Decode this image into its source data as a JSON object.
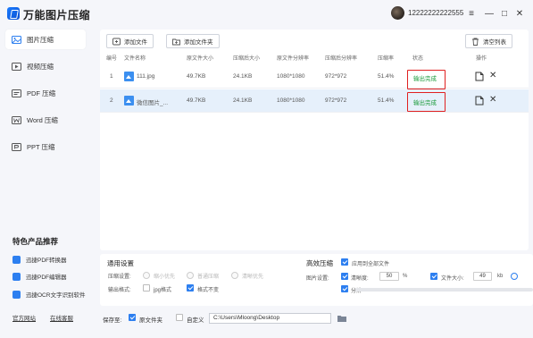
{
  "app": {
    "title": "万能图片压缩",
    "user_phone": "12222222222555"
  },
  "window_controls": {
    "list_icon": "≡",
    "minimize": "—",
    "maximize": "□",
    "close": "✕"
  },
  "sidebar": {
    "items": [
      {
        "label": "图片压缩",
        "icon": "image-icon"
      },
      {
        "label": "视频压缩",
        "icon": "video-icon"
      },
      {
        "label": "PDF 压缩",
        "icon": "pdf-icon"
      },
      {
        "label": "Word 压缩",
        "icon": "word-icon"
      },
      {
        "label": "PPT 压缩",
        "icon": "ppt-icon"
      }
    ],
    "feature_title": "特色产品推荐",
    "features": [
      {
        "label": "迅捷PDF转换器",
        "color": "#2d7ff0"
      },
      {
        "label": "迅捷PDF编辑器",
        "color": "#2d7ff0"
      },
      {
        "label": "迅捷OCR文字识别软件",
        "color": "#2d7ff0"
      }
    ],
    "footer": {
      "official_site": "官方网站",
      "feedback": "在线客服"
    }
  },
  "toolbar": {
    "add_file": "添加文件",
    "add_folder": "添加文件夹",
    "clear_list": "清空列表"
  },
  "table": {
    "headers": {
      "index": "编号",
      "name": "文件名称",
      "orig_size": "原文件大小",
      "new_size": "压缩后大小",
      "orig_res": "原文件分辨率",
      "new_res": "压缩后分辨率",
      "ratio": "压缩率",
      "status": "状态",
      "action": "操作"
    },
    "rows": [
      {
        "index": "1",
        "name": "111.jpg",
        "orig_size": "49.7KB",
        "new_size": "24.1KB",
        "orig_res": "1080*1080",
        "new_res": "972*972",
        "ratio": "51.4%",
        "status": "输出完成"
      },
      {
        "index": "2",
        "name": "微信图片_...",
        "orig_size": "49.7KB",
        "new_size": "24.1KB",
        "orig_res": "1080*1080",
        "new_res": "972*972",
        "ratio": "51.4%",
        "status": "输出完成"
      }
    ],
    "status_color": "#1a9a3a",
    "highlight_color": "#e02020"
  },
  "general_settings": {
    "title": "通用设置",
    "compress_settings_label": "压缩设置:",
    "options": [
      "缩小优先",
      "普通压缩",
      "清晰优先"
    ],
    "output_format_label": "输出格式:",
    "format_jpg": "jpg格式",
    "format_keep": "格式不变",
    "format_jpg_checked": false,
    "format_keep_checked": true
  },
  "efficient_settings": {
    "title": "高效压缩",
    "apply_all": "应用到全部文件",
    "apply_all_checked": true,
    "image_settings_label": "图片设置:",
    "clarity_label": "清晰度:",
    "clarity_checked": true,
    "clarity_value": "50",
    "clarity_unit": "%",
    "file_size_label": "文件大小:",
    "file_size_checked": true,
    "file_size_value": "49",
    "file_size_unit": "kb",
    "resolution_label": "分辨",
    "resolution_checked": true
  },
  "output": {
    "save_to_label": "保存至:",
    "original_folder": "原文件夹",
    "original_folder_checked": true,
    "custom": "自定义",
    "custom_checked": false,
    "path": "C:\\Users\\Mloong\\Desktop"
  },
  "accent_color": "#2d7ff0"
}
